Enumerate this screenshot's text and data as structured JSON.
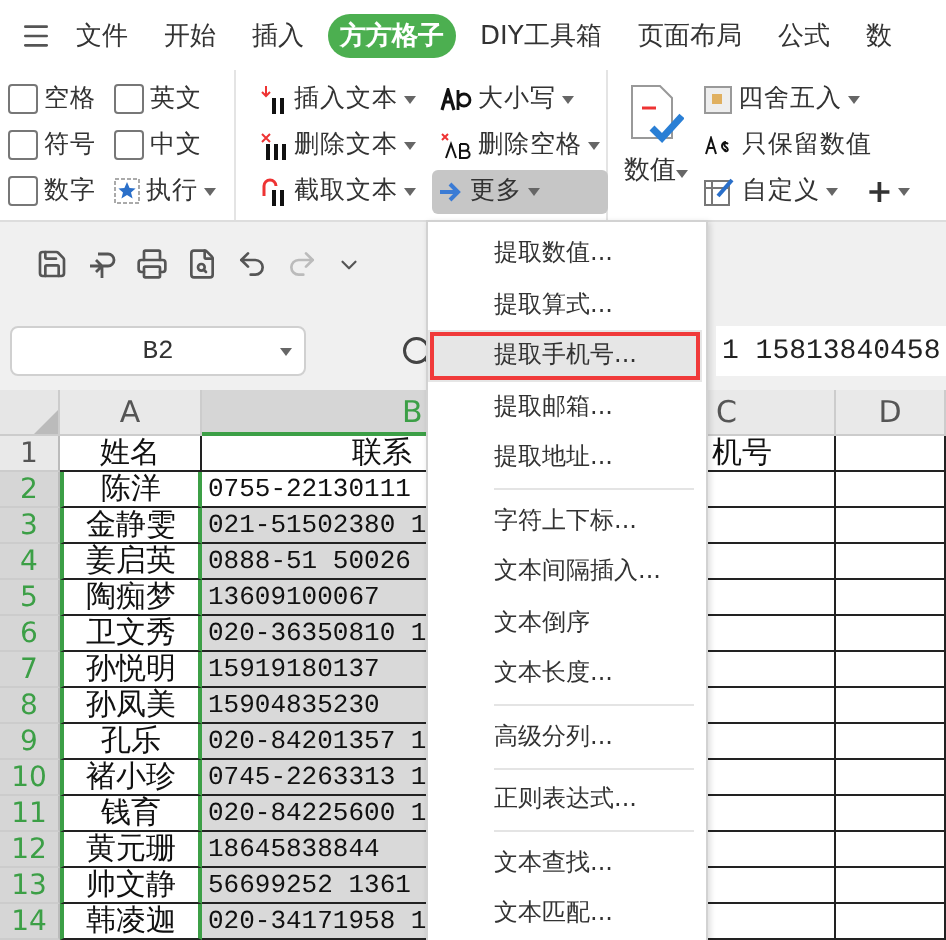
{
  "menu_tabs": [
    {
      "label": "文件",
      "selected": false
    },
    {
      "label": "开始",
      "selected": false
    },
    {
      "label": "插入",
      "selected": false
    },
    {
      "label": "方方格子",
      "selected": true
    },
    {
      "label": "DIY工具箱",
      "selected": false
    },
    {
      "label": "页面布局",
      "selected": false
    },
    {
      "label": "公式",
      "selected": false
    },
    {
      "label": "数",
      "selected": false
    }
  ],
  "ribbon": {
    "checkboxes": [
      {
        "label": "空格",
        "checked": false
      },
      {
        "label": "英文",
        "checked": false
      },
      {
        "label": "符号",
        "checked": false
      },
      {
        "label": "中文",
        "checked": false
      },
      {
        "label": "数字",
        "checked": false
      }
    ],
    "execute": "执行",
    "text_tools": [
      {
        "label": "插入文本",
        "kind": "insert",
        "pressed": false
      },
      {
        "label": "大小写",
        "kind": "case",
        "pressed": false
      },
      {
        "label": "删除文本",
        "kind": "delete",
        "pressed": false
      },
      {
        "label": "删除空格",
        "kind": "delspace",
        "pressed": false
      },
      {
        "label": "截取文本",
        "kind": "cut",
        "pressed": false
      },
      {
        "label": "更多",
        "kind": "more",
        "pressed": true
      }
    ],
    "value_button": "数值",
    "number_tools": [
      {
        "label": "四舍五入",
        "kind": "round",
        "dropdown": true
      },
      {
        "label": "只保留数值",
        "kind": "keep",
        "dropdown": false
      },
      {
        "label": "自定义",
        "kind": "custom",
        "dropdown": true
      }
    ],
    "plus": "+"
  },
  "name_box": "B2",
  "formula": "1 15813840458",
  "columns": [
    {
      "label": "A",
      "selected": false
    },
    {
      "label": "B",
      "selected": true
    },
    {
      "label": "C",
      "selected": false
    },
    {
      "label": "D",
      "selected": false
    }
  ],
  "rows": [
    {
      "number": "1",
      "name": "姓名",
      "contact": "联系",
      "extra": "机号",
      "selected": false
    },
    {
      "number": "2",
      "name": "陈洋",
      "contact": "0755-22130111",
      "selected": true
    },
    {
      "number": "3",
      "name": "金静雯",
      "contact": "021-51502380 1",
      "selected": true
    },
    {
      "number": "4",
      "name": "姜启英",
      "contact": "0888-51 50026",
      "selected": true
    },
    {
      "number": "5",
      "name": "陶痴梦",
      "contact": "13609100067",
      "selected": true
    },
    {
      "number": "6",
      "name": "卫文秀",
      "contact": "020-36350810 1",
      "selected": true
    },
    {
      "number": "7",
      "name": "孙悦明",
      "contact": "15919180137",
      "selected": true
    },
    {
      "number": "8",
      "name": "孙凤美",
      "contact": "15904835230",
      "selected": true
    },
    {
      "number": "9",
      "name": "孔乐",
      "contact": "020-84201357 1",
      "selected": true
    },
    {
      "number": "10",
      "name": "褚小珍",
      "contact": "0745-2263313 1",
      "selected": true
    },
    {
      "number": "11",
      "name": "钱育",
      "contact": "020-84225600 1",
      "selected": true
    },
    {
      "number": "12",
      "name": "黄元珊",
      "contact": "18645838844",
      "selected": true
    },
    {
      "number": "13",
      "name": "帅文静",
      "contact": "56699252 1361",
      "selected": true
    },
    {
      "number": "14",
      "name": "韩凌迦",
      "contact": "020-34171958 1",
      "selected": true
    }
  ],
  "dropdown_menu": [
    {
      "kind": "item",
      "label": "提取数值...",
      "selected": false
    },
    {
      "kind": "item",
      "label": "提取算式...",
      "selected": false
    },
    {
      "kind": "item",
      "label": "提取手机号...",
      "selected": true
    },
    {
      "kind": "item",
      "label": "提取邮箱...",
      "selected": false
    },
    {
      "kind": "item",
      "label": "提取地址...",
      "selected": false
    },
    {
      "kind": "separator"
    },
    {
      "kind": "item",
      "label": "字符上下标...",
      "selected": false
    },
    {
      "kind": "item",
      "label": "文本间隔插入...",
      "selected": false
    },
    {
      "kind": "item",
      "label": "文本倒序",
      "selected": false
    },
    {
      "kind": "item",
      "label": "文本长度...",
      "selected": false
    },
    {
      "kind": "separator"
    },
    {
      "kind": "item",
      "label": "高级分列...",
      "selected": false
    },
    {
      "kind": "separator"
    },
    {
      "kind": "item",
      "label": "正则表达式...",
      "selected": false
    },
    {
      "kind": "separator"
    },
    {
      "kind": "item",
      "label": "文本查找...",
      "selected": false
    },
    {
      "kind": "item",
      "label": "文本匹配...",
      "selected": false
    }
  ]
}
